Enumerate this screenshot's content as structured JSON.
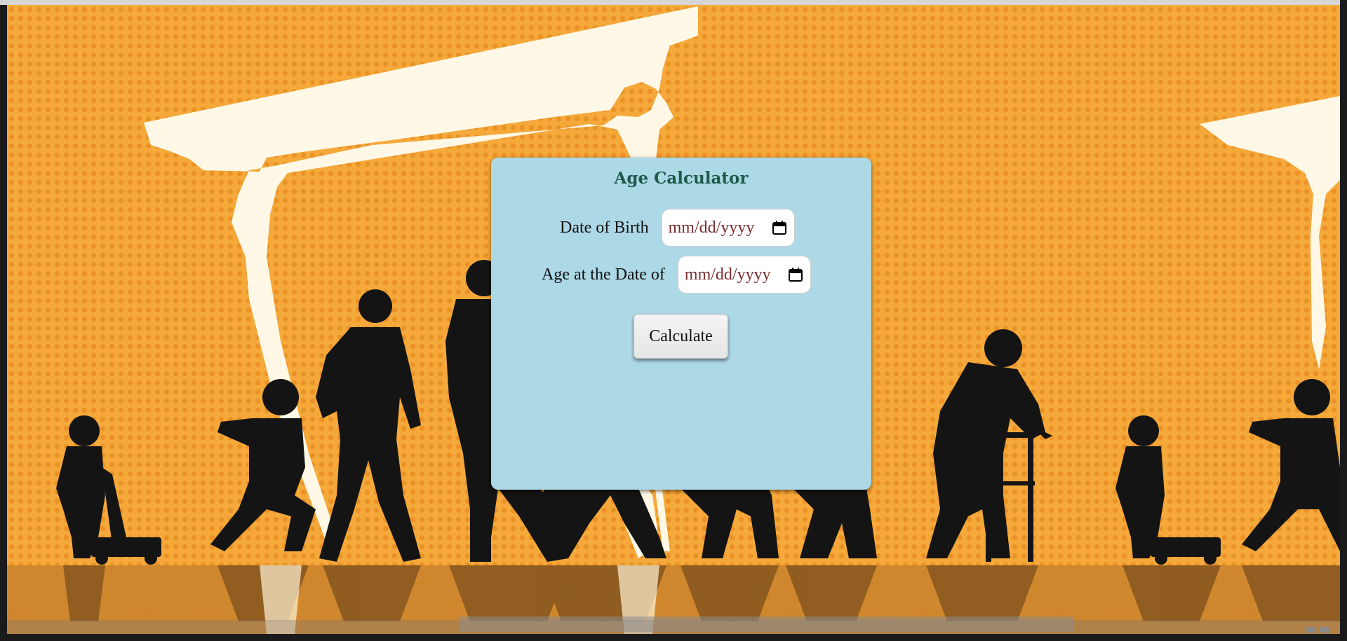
{
  "app": {
    "title": "Age Calculator"
  },
  "form": {
    "dob_label": "Date of Birth",
    "dob_placeholder": "mm/dd/yyyy",
    "dob_value": "",
    "target_label": "Age at the Date of",
    "target_placeholder": "mm/dd/yyyy",
    "target_value": "",
    "submit_label": "Calculate"
  },
  "icons": {
    "date_picker": "calendar-icon"
  },
  "colors": {
    "background_orange": "#f5a93a",
    "background_dot": "#eb9227",
    "card_background": "#add8e6",
    "title_color": "#1e5a4a",
    "date_text_color": "#7a2e2e"
  }
}
